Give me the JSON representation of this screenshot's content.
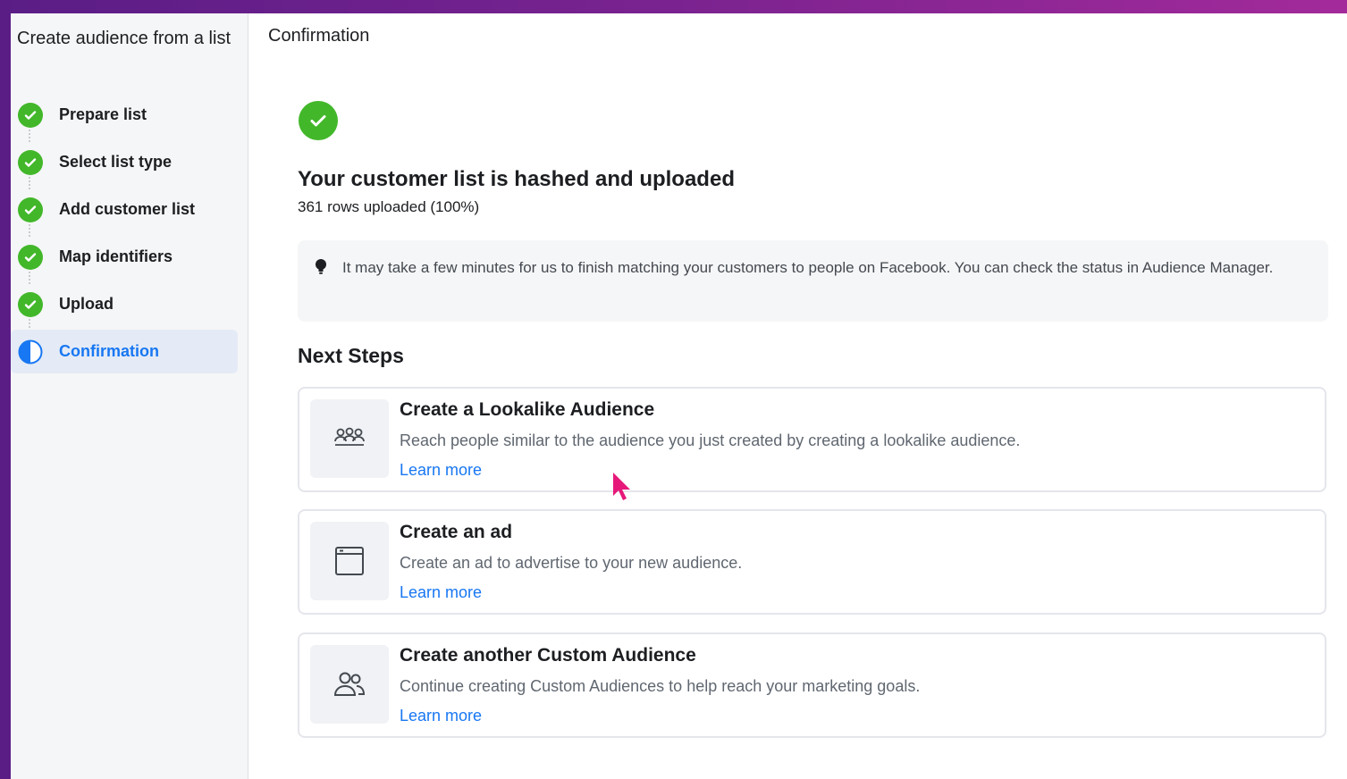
{
  "sidebar": {
    "title": "Create audience from a list",
    "steps": [
      {
        "label": "Prepare list",
        "status": "complete"
      },
      {
        "label": "Select list type",
        "status": "complete"
      },
      {
        "label": "Add customer list",
        "status": "complete"
      },
      {
        "label": "Map identifiers",
        "status": "complete"
      },
      {
        "label": "Upload",
        "status": "complete"
      },
      {
        "label": "Confirmation",
        "status": "active"
      }
    ]
  },
  "main": {
    "page_title": "Confirmation",
    "headline": "Your customer list is hashed and uploaded",
    "subline": "361 rows uploaded (100%)",
    "notice": "It may take a few minutes for us to finish matching your customers to people on Facebook. You can check the status in Audience Manager.",
    "next_steps_heading": "Next Steps",
    "cards": [
      {
        "icon": "group-icon",
        "title": "Create a Lookalike Audience",
        "description": "Reach people similar to the audience you just created by creating a lookalike audience.",
        "link": "Learn more"
      },
      {
        "icon": "ad-icon",
        "title": "Create an ad",
        "description": "Create an ad to advertise to your new audience.",
        "link": "Learn more"
      },
      {
        "icon": "people-icon",
        "title": "Create another Custom Audience",
        "description": "Continue creating Custom Audiences to help reach your marketing goals.",
        "link": "Learn more"
      }
    ]
  },
  "colors": {
    "success": "#42b72a",
    "link": "#1877f2",
    "active_bg": "#e4ebf6",
    "cursor": "#e6197a"
  }
}
